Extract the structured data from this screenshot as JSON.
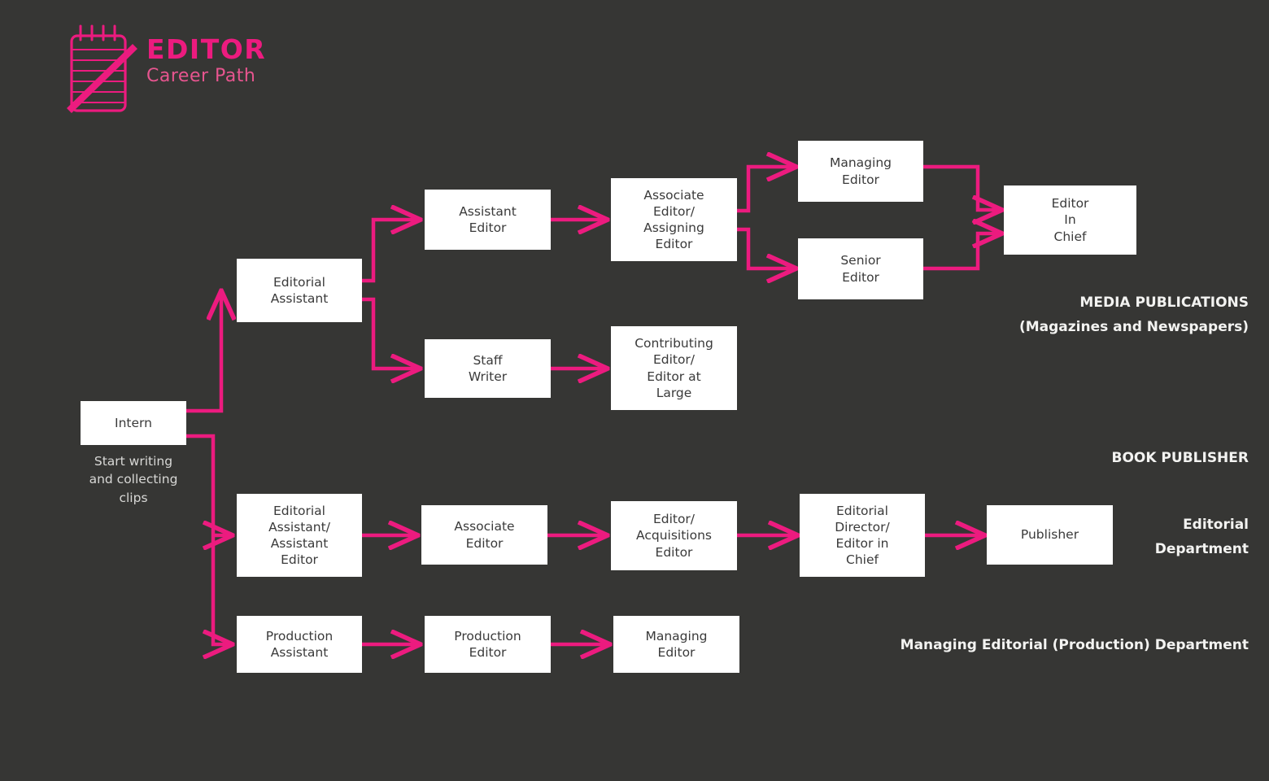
{
  "brand": {
    "title": "EDITOR",
    "subtitle": "Career Path",
    "logo_icon": "notepad-pencil-icon",
    "accent_color": "#ec1b7f",
    "background_color": "#363634",
    "node_fill": "#ffffff",
    "node_text_color": "#3a3a3a"
  },
  "start": {
    "label": "Intern",
    "caption": "Start writing\nand collecting\nclips"
  },
  "tracks": [
    {
      "name": "media-publications",
      "label": "MEDIA PUBLICATIONS\n(Magazines and Newspapers)",
      "nodes": [
        {
          "id": "editorial-assistant",
          "label": "Editorial\nAssistant"
        },
        {
          "id": "assistant-editor",
          "label": "Assistant\nEditor"
        },
        {
          "id": "associate-assigning",
          "label": "Associate\nEditor/\nAssigning\nEditor"
        },
        {
          "id": "managing-editor",
          "label": "Managing\nEditor"
        },
        {
          "id": "senior-editor",
          "label": "Senior\nEditor"
        },
        {
          "id": "editor-in-chief",
          "label": "Editor\nIn\nChief"
        },
        {
          "id": "staff-writer",
          "label": "Staff\nWriter"
        },
        {
          "id": "contributing-editor",
          "label": "Contributing\nEditor/\nEditor at\nLarge"
        }
      ]
    },
    {
      "name": "book-publisher",
      "label": "BOOK PUBLISHER",
      "departments": [
        {
          "name": "editorial-department",
          "label": "Editorial\nDepartment",
          "nodes": [
            {
              "id": "editorial-assistant-assistant-editor",
              "label": "Editorial\nAssistant/\nAssistant\nEditor"
            },
            {
              "id": "associate-editor",
              "label": "Associate\nEditor"
            },
            {
              "id": "editor-acquisitions",
              "label": "Editor/\nAcquisitions\nEditor"
            },
            {
              "id": "editorial-director",
              "label": "Editorial\nDirector/\nEditor in\nChief"
            },
            {
              "id": "publisher",
              "label": "Publisher"
            }
          ]
        },
        {
          "name": "managing-editorial-production-department",
          "label": "Managing Editorial (Production) Department",
          "nodes": [
            {
              "id": "production-assistant",
              "label": "Production\nAssistant"
            },
            {
              "id": "production-editor",
              "label": "Production\nEditor"
            },
            {
              "id": "managing-editor-prod",
              "label": "Managing\nEditor"
            }
          ]
        }
      ]
    }
  ]
}
